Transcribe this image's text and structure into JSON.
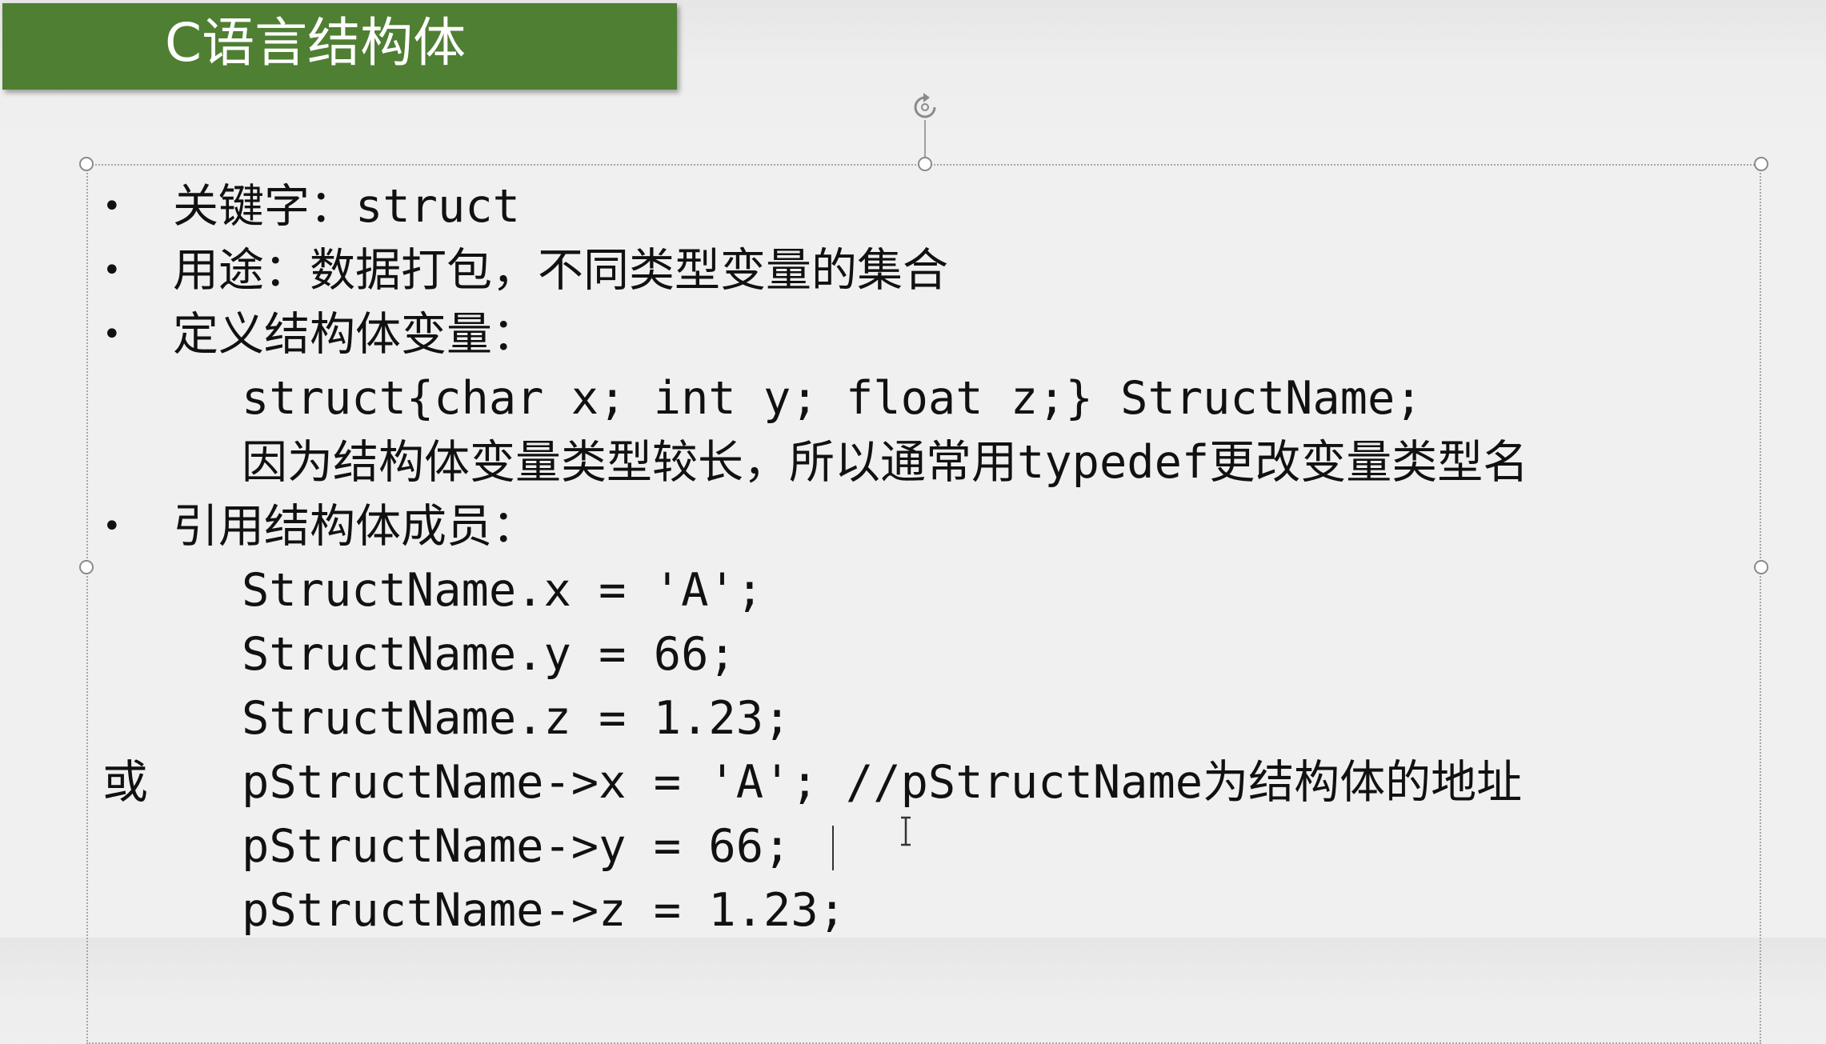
{
  "slide": {
    "title": "C语言结构体",
    "colors": {
      "title_bar": "#4f7f32",
      "title_text": "#ffffff",
      "body_text": "#111111",
      "background": "#f0f0f0"
    },
    "bullets": [
      {
        "text": "关键字：struct"
      },
      {
        "text": "用途：数据打包，不同类型变量的集合"
      },
      {
        "text": "定义结构体变量："
      },
      {
        "text": "引用结构体成员："
      }
    ],
    "define_lines": [
      "struct{char x; int y; float z;} StructName;",
      "因为结构体变量类型较长，所以通常用typedef更改变量类型名"
    ],
    "member_lines": [
      "StructName.x = 'A';",
      "StructName.y = 66;",
      "StructName.z = 1.23;"
    ],
    "or_label": "或",
    "pointer_lines": [
      "pStructName->x = 'A';   //pStructName为结构体的地址",
      "pStructName->y = 66;",
      "pStructName->z = 1.23;"
    ]
  },
  "icons": {
    "rotate_handle": "rotate-icon",
    "text_cursor": "ibeam-cursor-icon"
  }
}
